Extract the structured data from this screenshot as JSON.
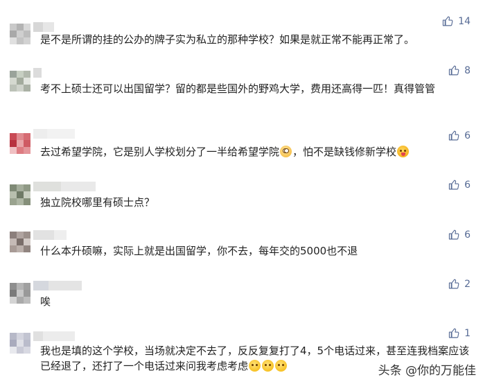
{
  "comments": [
    {
      "text": "是不是所谓的挂的公办的牌子实为私立的那种学校？如果是就正常不能再正常了。",
      "likes": "14"
    },
    {
      "text": "考不上硕士还可以出国留学？留的都是些国外的野鸡大学，费用还高得一匹！真得管管",
      "likes": "8"
    },
    {
      "text_a": "去过希望学院，它是别人学校划分了一半给希望学院",
      "text_b": "，怕不是缺钱修新学校",
      "likes": "6"
    },
    {
      "text": "独立院校哪里有硕士点？",
      "likes": "6"
    },
    {
      "text": "什么本升硕嘛，实际上就是出国留学，你不去，每年交的5000也不退",
      "likes": "6"
    },
    {
      "text": "唉",
      "likes": "2"
    },
    {
      "text": "我也是填的这个学校，当场就决定不去了，反反复复打了4，5个电话过来，甚至连我档案应该已经退了，还打了一个电话过来问我考虑考虑",
      "likes": "1"
    }
  ],
  "watermark": "头条 @你的万能佳",
  "icons": {
    "like": "thumbs-up-icon"
  },
  "colors": {
    "like": "#576b95",
    "text": "#222222"
  }
}
